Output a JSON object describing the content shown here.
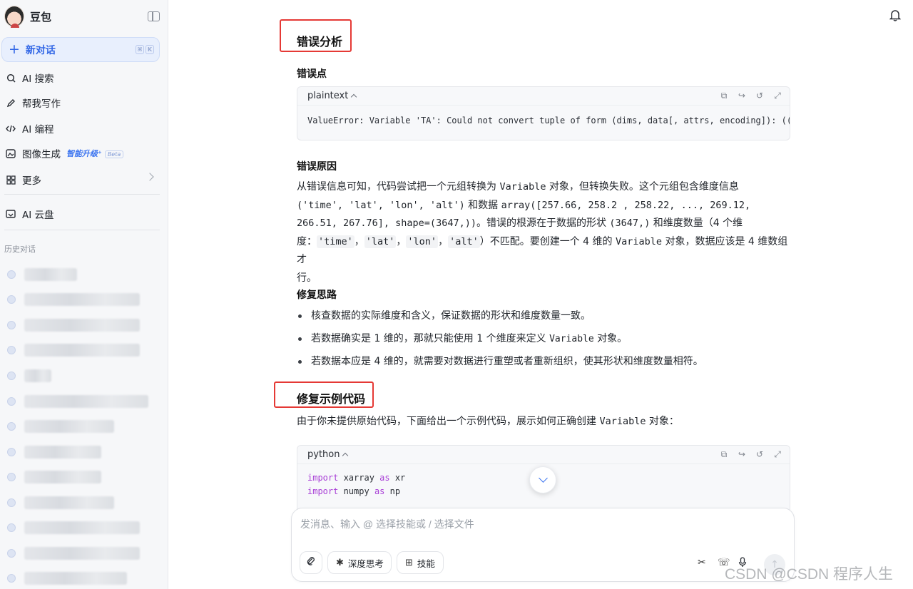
{
  "sidebar": {
    "brand": "豆包",
    "new_chat": "新对话",
    "shortcut": [
      "⌘",
      "K"
    ],
    "items": [
      {
        "label": "AI 搜索",
        "icon": "search-icon"
      },
      {
        "label": "帮我写作",
        "icon": "pen-icon"
      },
      {
        "label": "AI 编程",
        "icon": "code-icon"
      },
      {
        "label": "图像生成",
        "icon": "image-icon",
        "badge": "智能升级",
        "beta": "Beta"
      },
      {
        "label": "更多",
        "icon": "grid-icon"
      },
      {
        "label": "AI 云盘",
        "icon": "cloud-drive-icon"
      }
    ],
    "history_title": "历史对话"
  },
  "main": {
    "h_error_analysis": "错误分析",
    "h_error_point": "错误点",
    "code1": {
      "lang": "plaintext",
      "body": "ValueError: Variable 'TA': Could not convert tuple of form (dims, data[, attrs, encoding]): (('tim"
    },
    "h_error_reason": "错误原因",
    "reason": {
      "l1a": "从错误信息可知，代码尝试把一个元组转换为 ",
      "l1b": "Variable",
      "l1c": " 对象，但转换失败。这个元组包含维度信息",
      "l2a": "('time', 'lat', 'lon', 'alt')",
      "l2b": " 和数据 ",
      "l2c": "array([257.66, 258.2 , 258.22, ..., 269.12,",
      "l3a": "266.51, 267.76], shape=(3647,))",
      "l3b": "。错误的根源在于数据的形状 ",
      "l3c": "(3647,)",
      "l3d": " 和维度数量（4 个维",
      "l4a": "度：",
      "l4_time": "'time'",
      "l4_lat": "'lat'",
      "l4_lon": "'lon'",
      "l4_alt": "'alt'",
      "l4b": "）不匹配。要创建一个 4 维的 ",
      "l4c": "Variable",
      "l4d": " 对象，数据应该是 4 维数组才",
      "l5": "行。",
      "sep": "，"
    },
    "h_fix_idea": "修复思路",
    "fix_list": [
      "核查数据的实际维度和含义，保证数据的形状和维度数量一致。",
      "若数据确实是 1 维的，那就只能使用 1 个维度来定义 ",
      "若数据本应是 4 维的，就需要对数据进行重塑或者重新组织，使其形状和维度数量相符。"
    ],
    "fix_list_code": "Variable",
    "fix_list_tail": " 对象。",
    "h_fix_example": "修复示例代码",
    "example_intro_a": "由于你未提供原始代码，下面给出一个示例代码，展示如何正确创建 ",
    "example_intro_b": "Variable",
    "example_intro_c": " 对象：",
    "code2": {
      "lang": "python",
      "line1_kw": "import",
      "line1_mod": " xarray ",
      "line1_as": "as",
      "line1_alias": " xr",
      "line2_kw": "import",
      "line2_mod": " numpy ",
      "line2_as": "as",
      "line2_alias": " np"
    }
  },
  "composer": {
    "placeholder": "发消息、输入 @ 选择技能或 / 选择文件",
    "deep_think": "深度思考",
    "skills": "技能"
  },
  "watermark": "CSDN @CSDN 程序人生"
}
